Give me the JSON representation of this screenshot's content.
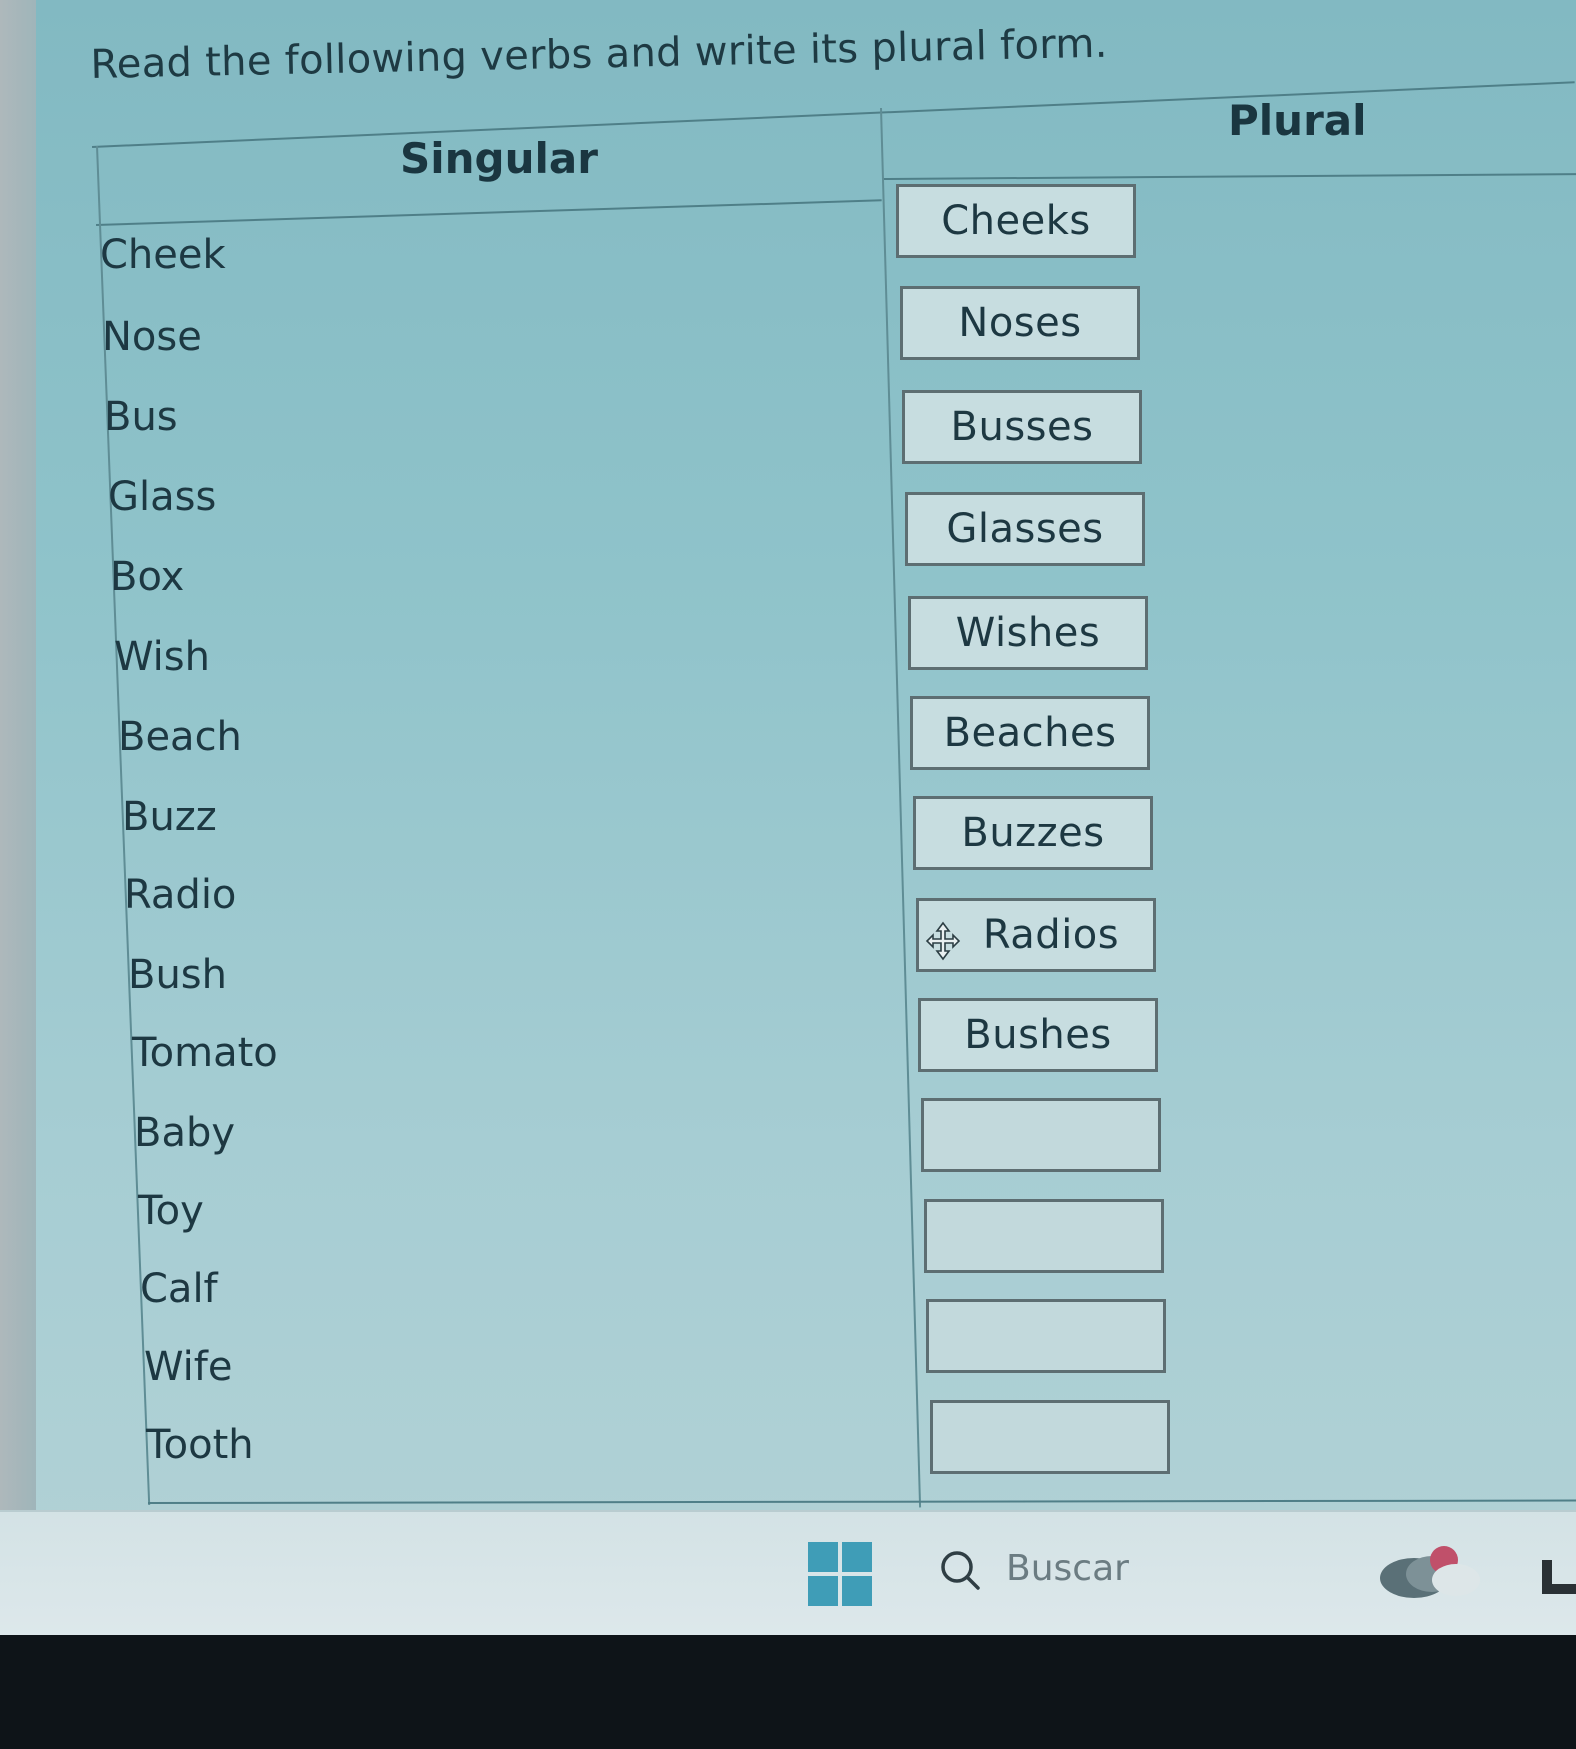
{
  "instruction": "Read the following verbs and write its plural form.",
  "headers": {
    "singular": "Singular",
    "plural": "Plural"
  },
  "rows": [
    {
      "singular": "Cheek",
      "plural": "Cheeks"
    },
    {
      "singular": "Nose",
      "plural": "Noses"
    },
    {
      "singular": "Bus",
      "plural": "Busses"
    },
    {
      "singular": "Glass",
      "plural": "Glasses"
    },
    {
      "singular": "Box",
      "plural": "Wishes"
    },
    {
      "singular": "Wish",
      "plural": "Beaches"
    },
    {
      "singular": "Beach",
      "plural": "Buzzes"
    },
    {
      "singular": "Buzz",
      "plural": "Radios"
    },
    {
      "singular": "Radio",
      "plural": "Bushes"
    },
    {
      "singular": "Bush",
      "plural": ""
    },
    {
      "singular": "Tomato",
      "plural": ""
    },
    {
      "singular": "Baby",
      "plural": ""
    },
    {
      "singular": "Toy",
      "plural": ""
    },
    {
      "singular": "Calf",
      "plural": ""
    },
    {
      "singular": "Wife",
      "plural": ""
    },
    {
      "singular": "Tooth",
      "plural": ""
    }
  ],
  "plural_boxes": [
    "Cheeks",
    "Noses",
    "Busses",
    "Glasses",
    "Wishes",
    "Beaches",
    "Buzzes",
    "Radios",
    "Bushes",
    "",
    "",
    "",
    ""
  ],
  "taskbar": {
    "search_label": "Buscar",
    "icons": [
      "windows-start-icon",
      "search-icon",
      "weather-widget-icon",
      "app-icon"
    ],
    "accent": "#3f9db7"
  },
  "colors": {
    "worksheet_bg": "#8fc3ca",
    "box_border": "#5d6e72",
    "text": "#1d3842"
  }
}
